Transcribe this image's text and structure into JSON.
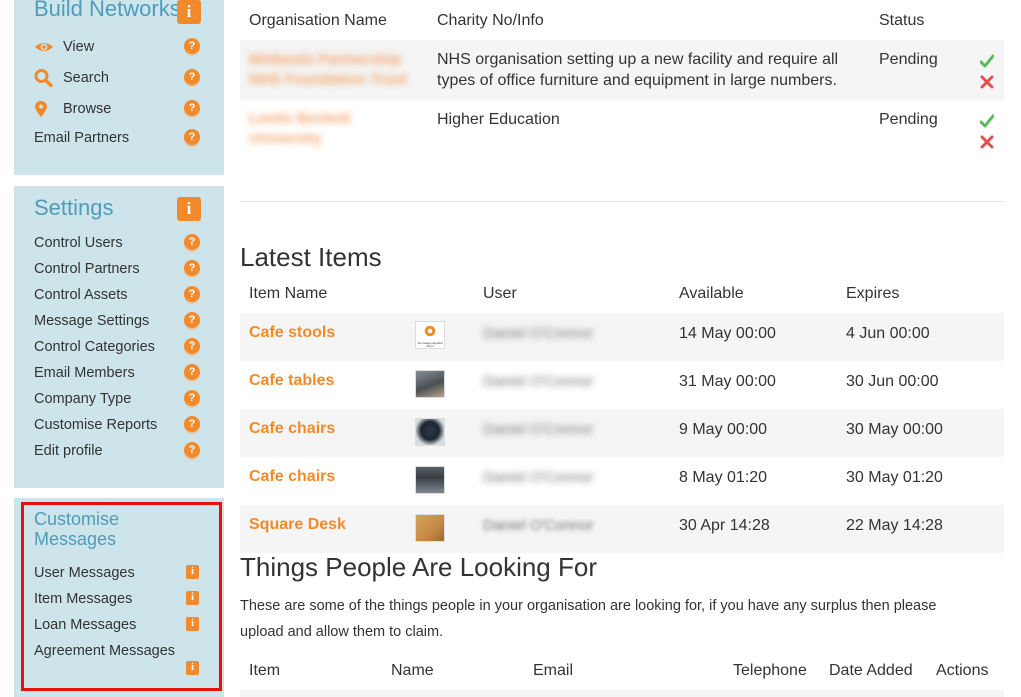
{
  "sidebar": {
    "build_networks": {
      "title": "Build Networks",
      "items": [
        {
          "label": "View",
          "icon": "eye-icon"
        },
        {
          "label": "Search",
          "icon": "search-icon"
        },
        {
          "label": "Browse",
          "icon": "location-pin-icon"
        },
        {
          "label": "Email Partners",
          "icon": ""
        }
      ]
    },
    "settings": {
      "title": "Settings",
      "items": [
        {
          "label": "Control Users"
        },
        {
          "label": "Control Partners"
        },
        {
          "label": "Control Assets"
        },
        {
          "label": "Message Settings"
        },
        {
          "label": "Control Categories"
        },
        {
          "label": "Email Members"
        },
        {
          "label": "Company Type"
        },
        {
          "label": "Customise Reports"
        },
        {
          "label": "Edit profile"
        }
      ]
    },
    "customise_messages": {
      "title_line1": "Customise",
      "title_line2": "Messages",
      "items": [
        {
          "label": "User Messages"
        },
        {
          "label": "Item Messages"
        },
        {
          "label": "Loan Messages"
        },
        {
          "label": "Agreement Messages"
        }
      ]
    },
    "help_glyph": "?",
    "info_glyph": "i"
  },
  "partners_table": {
    "headers": {
      "org": "Organisation Name",
      "charity": "Charity No/Info",
      "status": "Status"
    },
    "rows": [
      {
        "org": "Midlands Partnership NHS Foundation Trust",
        "info_line1": "NHS organisation setting up a new facility and require all",
        "info_line2": "types of office furniture and equipment in large numbers.",
        "status": "Pending"
      },
      {
        "org": "Leeds Beckett University",
        "info_line1": "Higher Education",
        "info_line2": "",
        "status": "Pending"
      }
    ]
  },
  "latest_items": {
    "title": "Latest Items",
    "headers": {
      "name": "Item Name",
      "user": "User",
      "available": "Available",
      "expires": "Expires"
    },
    "rows": [
      {
        "name": "Cafe stools",
        "user": "Daniel O'Connor",
        "available": "14 May 00:00",
        "expires": "4 Jun 00:00",
        "thumb_caption": "No image supplied sorry!"
      },
      {
        "name": "Cafe tables",
        "user": "Daniel O'Connor",
        "available": "31 May 00:00",
        "expires": "30 Jun 00:00"
      },
      {
        "name": "Cafe chairs",
        "user": "Daniel O'Connor",
        "available": "9 May 00:00",
        "expires": "30 May 00:00"
      },
      {
        "name": "Cafe chairs",
        "user": "Daniel O'Connor",
        "available": "8 May 01:20",
        "expires": "30 May 01:20"
      },
      {
        "name": "Square Desk",
        "user": "Daniel O'Connor",
        "available": "30 Apr 14:28",
        "expires": "22 May 14:28"
      }
    ]
  },
  "looking_for": {
    "title": "Things People Are Looking For",
    "description_line1": "These are some of the things people in your organisation are looking for, if you have any surplus then please",
    "description_line2": "upload and allow them to claim.",
    "headers": {
      "item": "Item",
      "name": "Name",
      "email": "Email",
      "telephone": "Telephone",
      "date_added": "Date Added",
      "actions": "Actions"
    }
  },
  "colors": {
    "accent": "#f08a2c",
    "sidebar_bg": "#cde4ea",
    "sidebar_title": "#4f9cba",
    "highlight": "#e41111",
    "approve": "#5cb85c",
    "reject": "#e05050"
  }
}
